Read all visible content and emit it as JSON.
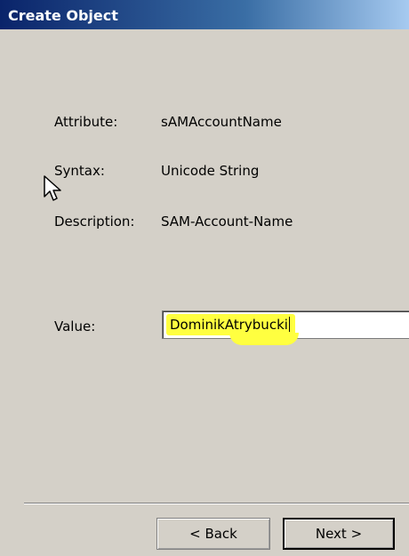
{
  "window": {
    "title": "Create Object"
  },
  "fields": {
    "attribute_label": "Attribute:",
    "attribute_value": "sAMAccountName",
    "syntax_label": "Syntax:",
    "syntax_value": "Unicode String",
    "description_label": "Description:",
    "description_value": "SAM-Account-Name",
    "value_label": "Value:",
    "value_input": "DominikAtrybucki"
  },
  "buttons": {
    "back": "< Back",
    "next": "Next >"
  },
  "colors": {
    "highlight": "#ffff40",
    "dialog_bg": "#d4d0c8",
    "title_start": "#0a246a"
  },
  "icons": {
    "cursor": "mouse-pointer-icon"
  }
}
